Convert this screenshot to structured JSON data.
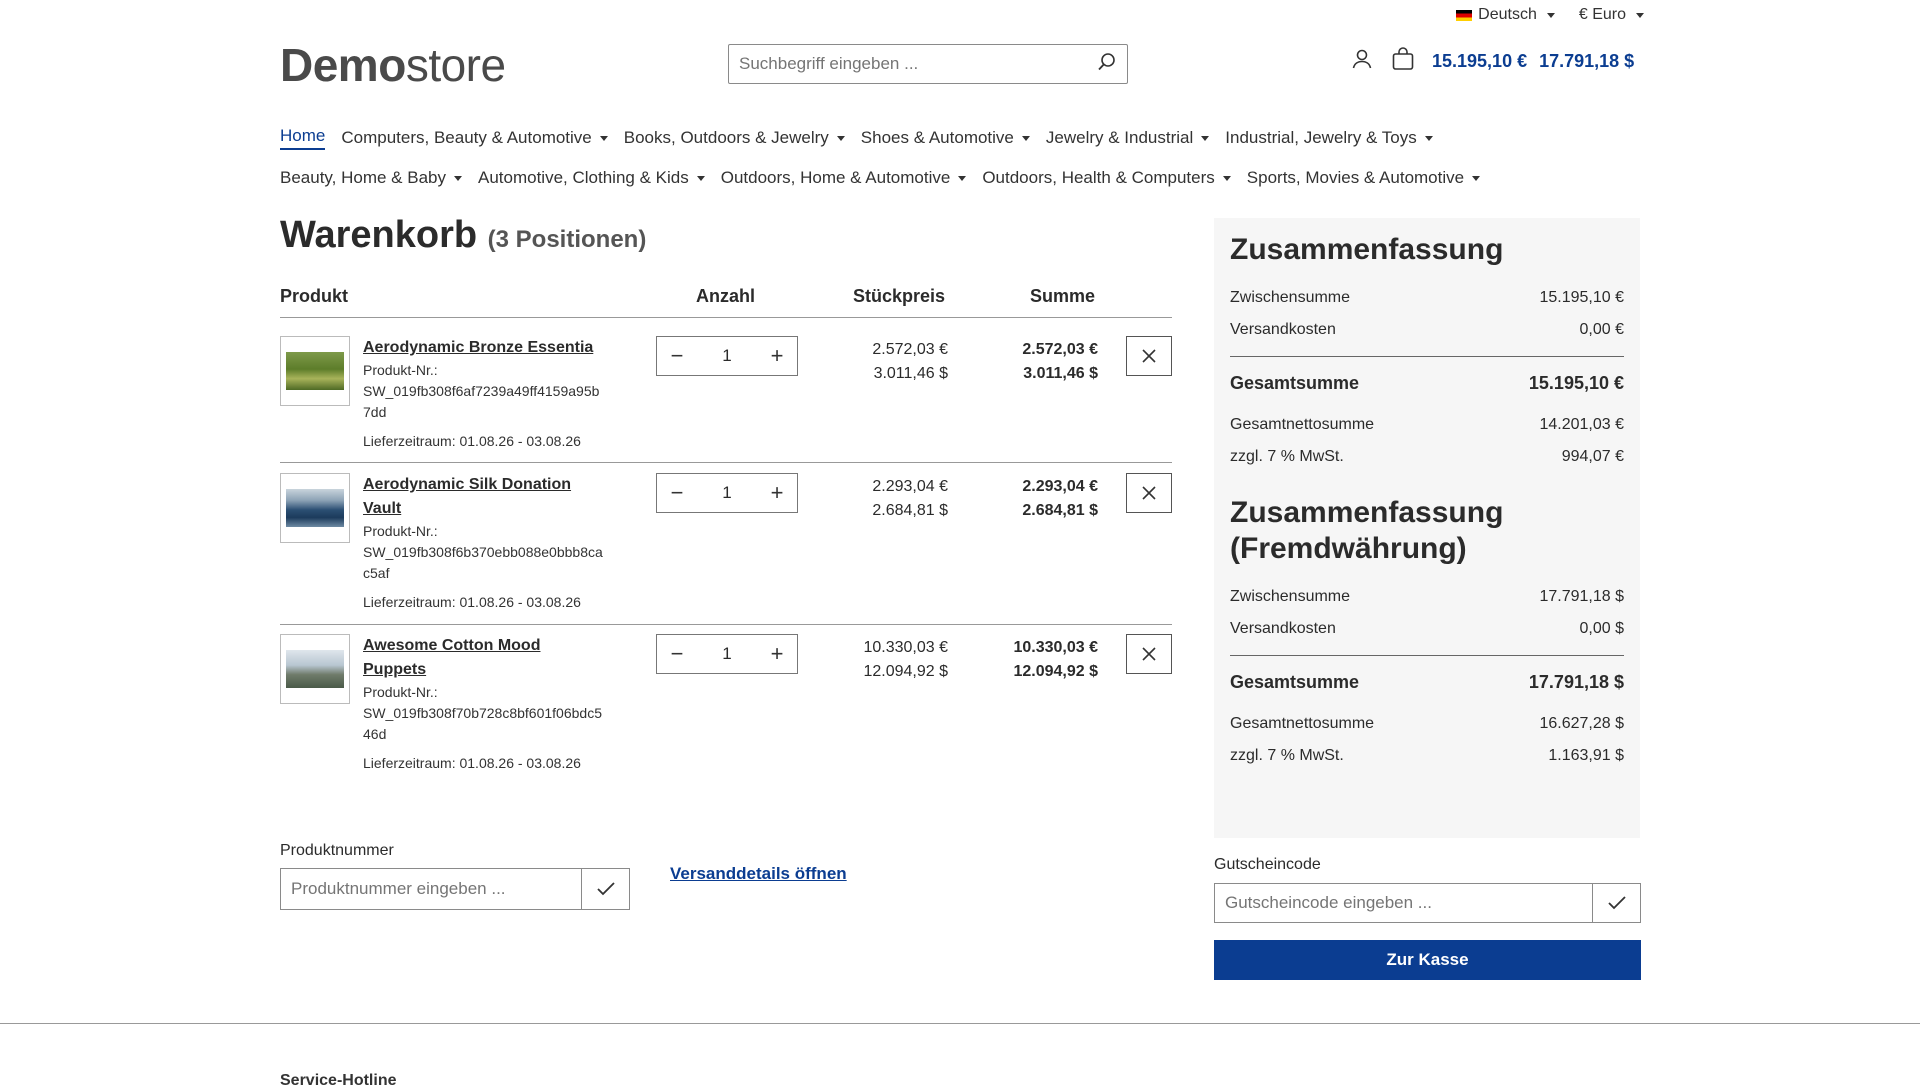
{
  "topbar": {
    "language": "Deutsch",
    "currency": "€ Euro"
  },
  "header": {
    "logo_bold": "Demo",
    "logo_light": "store",
    "search_placeholder": "Suchbegriff eingeben ...",
    "cart_total_eur": "15.195,10 €",
    "cart_total_usd": "17.791,18 $"
  },
  "nav": {
    "row1": [
      {
        "label": "Home",
        "active": true,
        "dropdown": false
      },
      {
        "label": "Computers, Beauty & Automotive",
        "dropdown": true
      },
      {
        "label": "Books, Outdoors & Jewelry",
        "dropdown": true
      },
      {
        "label": "Shoes & Automotive",
        "dropdown": true
      },
      {
        "label": "Jewelry & Industrial",
        "dropdown": true
      },
      {
        "label": "Industrial, Jewelry & Toys",
        "dropdown": true
      }
    ],
    "row2": [
      {
        "label": "Beauty, Home & Baby",
        "dropdown": true
      },
      {
        "label": "Automotive, Clothing & Kids",
        "dropdown": true
      },
      {
        "label": "Outdoors, Home & Automotive",
        "dropdown": true
      },
      {
        "label": "Outdoors, Health & Computers",
        "dropdown": true
      },
      {
        "label": "Sports, Movies & Automotive",
        "dropdown": true
      }
    ]
  },
  "cart": {
    "title": "Warenkorb",
    "count": "(3 Positionen)",
    "headers": {
      "product": "Produkt",
      "qty": "Anzahl",
      "unit": "Stückpreis",
      "total": "Summe"
    },
    "items": [
      {
        "name": "Aerodynamic Bronze Essentia",
        "number_label": "Produkt-Nr.:",
        "number": "SW_019fb308f6af7239a49ff4159a95b7dd",
        "delivery": "Lieferzeitraum: 01.08.26 - 03.08.26",
        "qty": "1",
        "unit_eur": "2.572,03 €",
        "unit_usd": "3.011,46 $",
        "total_eur": "2.572,03 €",
        "total_usd": "3.011,46 $"
      },
      {
        "name": "Aerodynamic Silk Donation Vault",
        "number_label": "Produkt-Nr.:",
        "number": "SW_019fb308f6b370ebb088e0bbb8cac5af",
        "delivery": "Lieferzeitraum: 01.08.26 - 03.08.26",
        "qty": "1",
        "unit_eur": "2.293,04 €",
        "unit_usd": "2.684,81 $",
        "total_eur": "2.293,04 €",
        "total_usd": "2.684,81 $"
      },
      {
        "name": "Awesome Cotton Mood Puppets",
        "number_label": "Produkt-Nr.:",
        "number": "SW_019fb308f70b728c8bf601f06bdc546d",
        "delivery": "Lieferzeitraum: 01.08.26 - 03.08.26",
        "qty": "1",
        "unit_eur": "10.330,03 €",
        "unit_usd": "12.094,92 $",
        "total_eur": "10.330,03 €",
        "total_usd": "12.094,92 $"
      }
    ]
  },
  "summary": {
    "title": "Zusammenfassung",
    "subtotal_label": "Zwischensumme",
    "subtotal": "15.195,10 €",
    "shipping_label": "Versandkosten",
    "shipping": "0,00 €",
    "grand_label": "Gesamtsumme",
    "grand": "15.195,10 €",
    "net_label": "Gesamtnettosumme",
    "net": "14.201,03 €",
    "tax_label": "zzgl. 7 % MwSt.",
    "tax": "994,07 €"
  },
  "summary_fx": {
    "title_line1": "Zusammenfassung",
    "title_line2": "(Fremdwährung)",
    "subtotal_label": "Zwischensumme",
    "subtotal": "17.791,18 $",
    "shipping_label": "Versandkosten",
    "shipping": "0,00 $",
    "grand_label": "Gesamtsumme",
    "grand": "17.791,18 $",
    "net_label": "Gesamtnettosumme",
    "net": "16.627,28 $",
    "tax_label": "zzgl. 7 % MwSt.",
    "tax": "1.163,91 $"
  },
  "product_number": {
    "label": "Produktnummer",
    "placeholder": "Produktnummer eingeben ..."
  },
  "shipping_link": "Versanddetails öffnen",
  "voucher": {
    "label": "Gutscheincode",
    "placeholder": "Gutscheincode eingeben ..."
  },
  "checkout_label": "Zur Kasse",
  "footer": {
    "peek": "Service-Hotline"
  },
  "colors": {
    "accent": "#0b3d91"
  }
}
